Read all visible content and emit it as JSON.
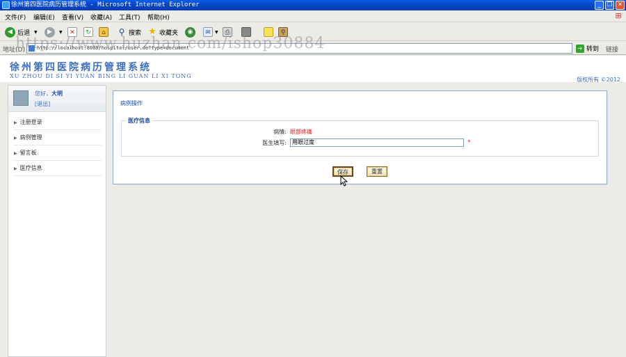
{
  "window": {
    "title": "徐州第四医院病历管理系统 - Microsoft Internet Explorer",
    "minimize_glyph": "_",
    "maximize_glyph": "❐",
    "close_glyph": "✕"
  },
  "menu": [
    "文件(F)",
    "编辑(E)",
    "查看(V)",
    "收藏(A)",
    "工具(T)",
    "帮助(H)"
  ],
  "toolbar": {
    "back_label": "后退",
    "search_label": "搜索",
    "favorites_label": "收藏夹"
  },
  "address": {
    "label": "地址(D)",
    "url": "http://localhost:8080/hospital/user.do?type=document",
    "go_label": "转到",
    "links_label": "链接"
  },
  "watermark": "https://www.huzhan.com/ishop30884",
  "site": {
    "title": "徐州第四医院病历管理系统",
    "subtitle": "XU ZHOU DI SI YI YUAN BING LI GUAN LI XI TONG",
    "copyright": "版权所有 ©2012"
  },
  "user": {
    "greeting_prefix": "您好，",
    "name": "大明",
    "logout_label": "[退出]"
  },
  "nav": [
    "注册登录",
    "病例管理",
    "留言板",
    "医疗信息"
  ],
  "main": {
    "breadcrumb": "病例操作",
    "section_title": "医疗信息",
    "disease_label": "病情:",
    "disease_value": "眼部疼痛",
    "doctor_label": "医生填写:",
    "doctor_value": "用眼过度",
    "required_mark": "*",
    "save_label": "保存",
    "reset_label": "重置"
  },
  "colors": {
    "accent": "#3a6cc0",
    "required": "#dd2222"
  }
}
